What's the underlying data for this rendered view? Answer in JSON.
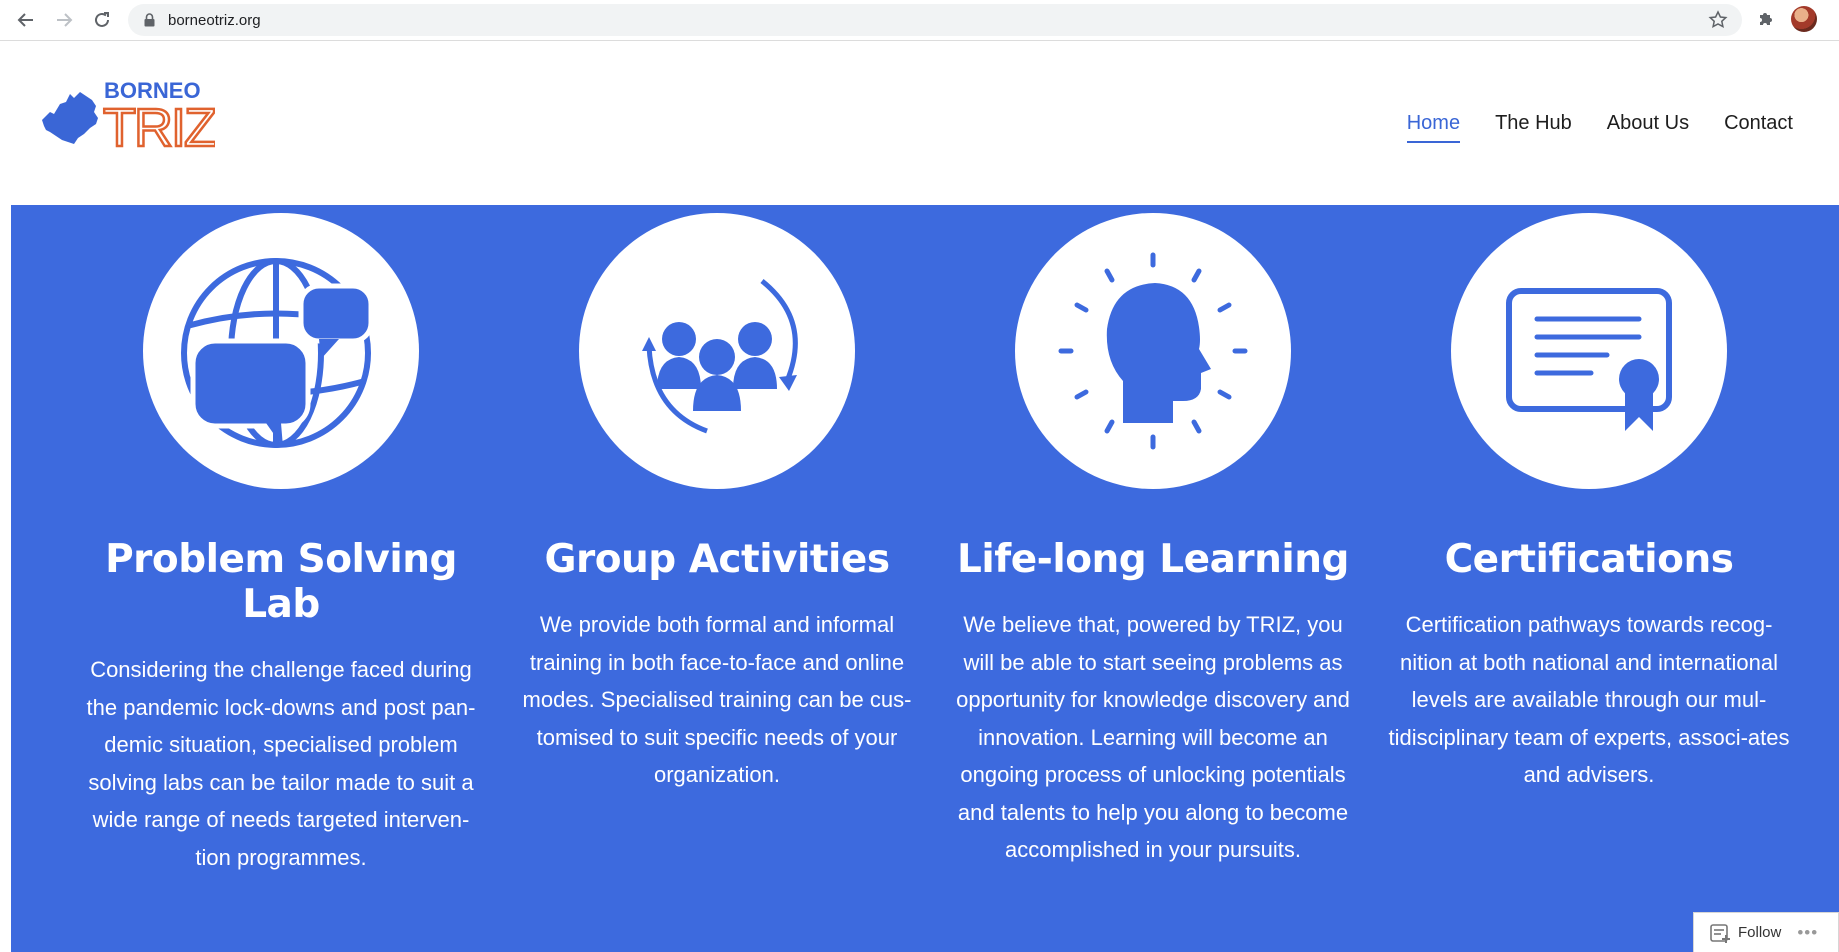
{
  "browser": {
    "url": "borneotriz.org",
    "icons": [
      "back-arrow-icon",
      "forward-arrow-icon",
      "reload-icon",
      "lock-icon",
      "bookmark-star-icon",
      "extensions-puzzle-icon",
      "profile-avatar"
    ]
  },
  "site": {
    "logo": {
      "line1": "BORNEO",
      "line2": "TRIZ"
    },
    "nav": [
      {
        "label": "Home",
        "active": true
      },
      {
        "label": "The Hub",
        "active": false
      },
      {
        "label": "About Us",
        "active": false
      },
      {
        "label": "Contact",
        "active": false
      }
    ]
  },
  "features": [
    {
      "icon": "globe-chat-bubbles-icon",
      "title": "Problem Solving Lab",
      "text": "Considering the challenge faced during the pandemic lock-downs and post pan-demic situation, specialised problem solving labs can be tailor made to suit a wide range of needs targeted interven-tion programmes."
    },
    {
      "icon": "group-people-cycle-icon",
      "title": "Group Activities",
      "text": "We provide both formal and informal training in both face-to-face and online modes. Specialised training can be cus-tomised to suit specific needs of your organization."
    },
    {
      "icon": "head-ideas-icon",
      "title": "Life-long Learning",
      "text": "We believe that, powered by TRIZ, you will be able to start seeing problems as opportunity for knowledge discovery and innovation. Learning will become an ongoing process of unlocking potentials and talents to help you along to become accomplished in your pursuits."
    },
    {
      "icon": "certificate-ribbon-icon",
      "title": "Certifications",
      "text": "Certification pathways towards recog-nition at both national and international levels are available through our mul-tidisciplinary team of experts, associ-ates and advisers."
    }
  ],
  "follow_widget": {
    "label": "Follow",
    "more": "•••"
  },
  "colors": {
    "band": "#3d6ade",
    "accent": "#3a66d6",
    "logo_orange": "#e0622e",
    "logo_blue": "#3a66d6"
  }
}
